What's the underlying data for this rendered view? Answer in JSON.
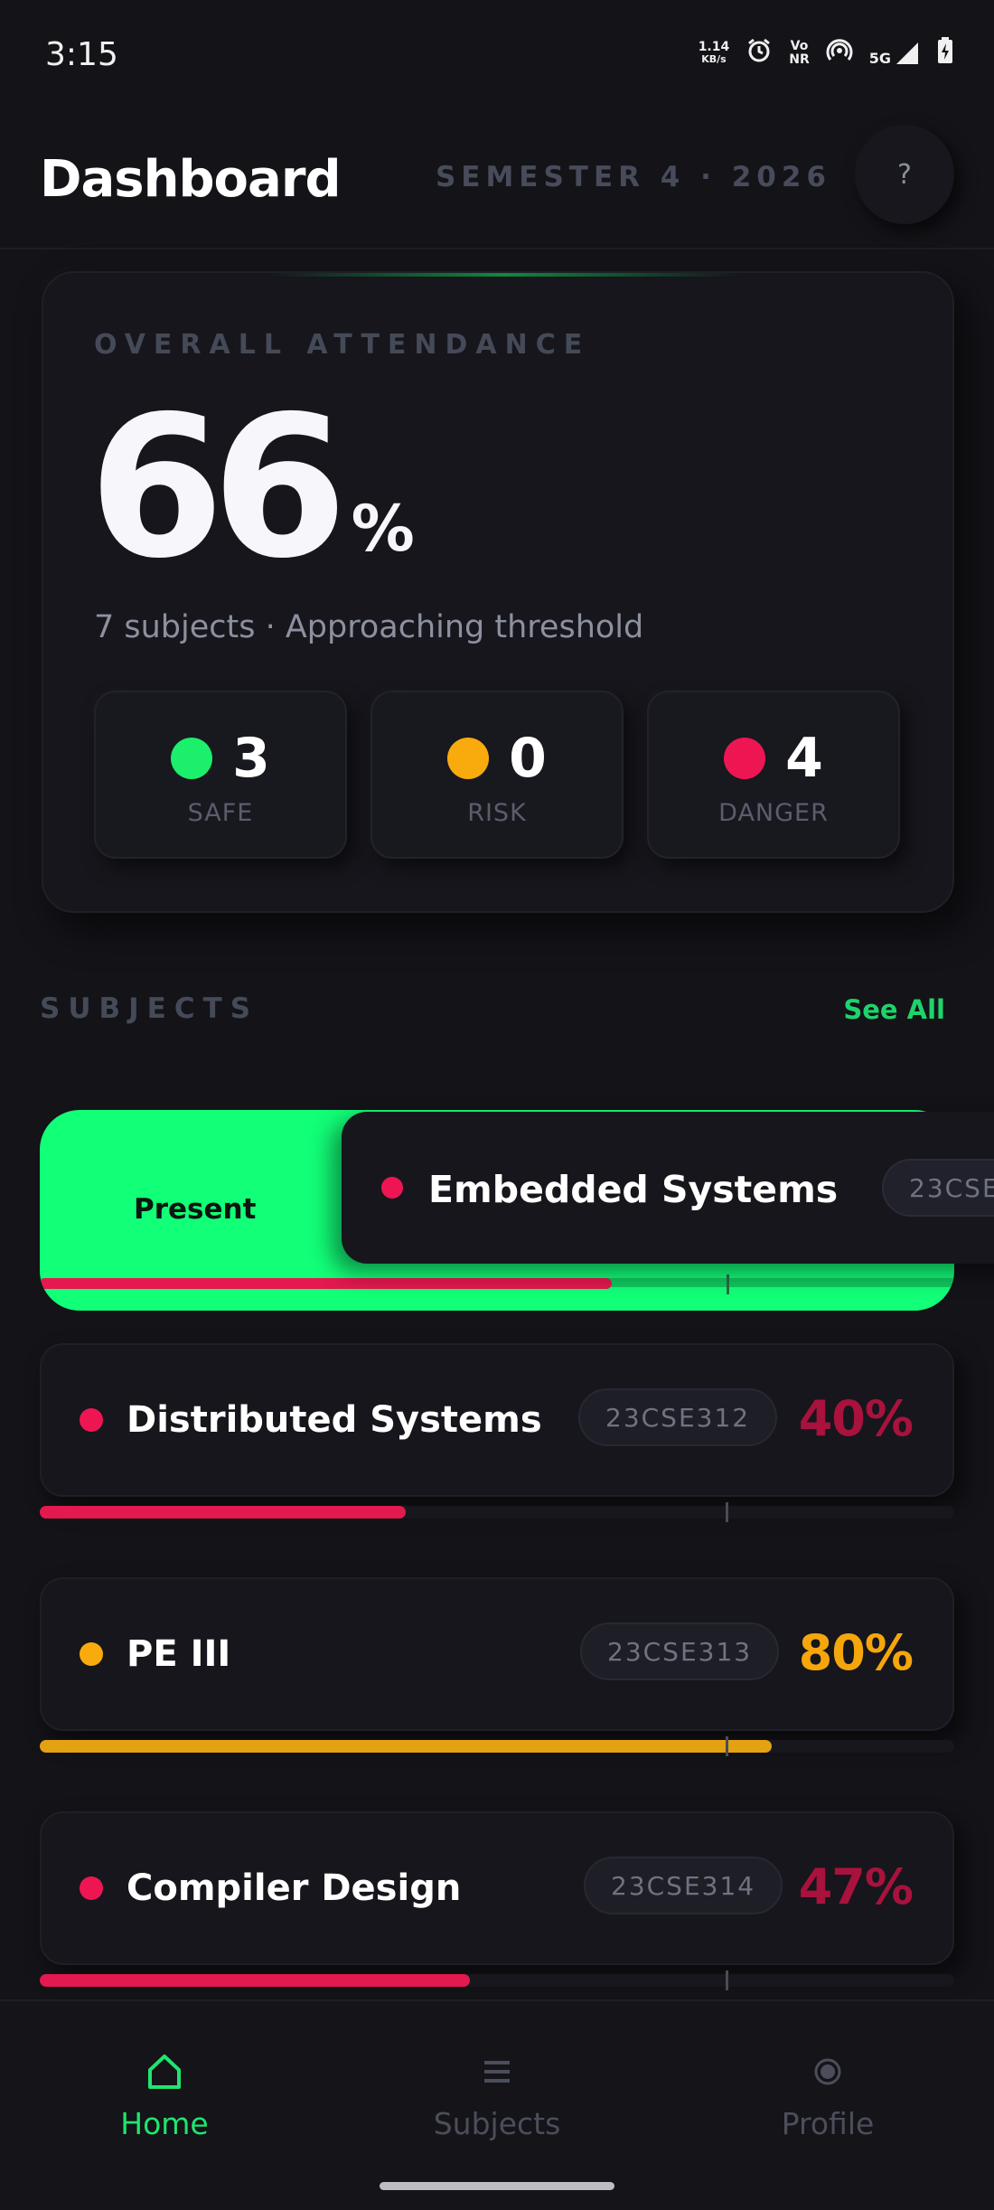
{
  "status_bar": {
    "time": "3:15",
    "net_speed_value": "1.14",
    "net_speed_unit": "KB/s",
    "vonr_top": "Vo",
    "vonr_bottom": "NR",
    "network": "5G"
  },
  "header": {
    "title": "Dashboard",
    "semester": "SEMESTER 4 · 2026",
    "help_label": "?"
  },
  "overall": {
    "label": "OVERALL ATTENDANCE",
    "percent": "66",
    "percent_sign": "%",
    "subtitle": "7 subjects · Approaching threshold",
    "stats": [
      {
        "count": "3",
        "label": "SAFE",
        "color": "#1bef6c"
      },
      {
        "count": "0",
        "label": "RISK",
        "color": "#f9ab0e"
      },
      {
        "count": "4",
        "label": "DANGER",
        "color": "#ee1652"
      }
    ]
  },
  "subjects_section": {
    "title": "SUBJECTS",
    "see_all": "See All"
  },
  "swiped_subject": {
    "action_label": "Present",
    "name": "Embedded Systems",
    "code": "23CSE",
    "status_color": "#ee1652",
    "progress": 0.625
  },
  "subjects": [
    {
      "name": "Distributed Systems",
      "code": "23CSE312",
      "percent": "40%",
      "color": "#ee1652",
      "percent_color": "#a8123c",
      "progress": 0.4
    },
    {
      "name": "PE III",
      "code": "23CSE313",
      "percent": "80%",
      "color": "#f9ab0e",
      "percent_color": "#f5a60c",
      "progress": 0.8
    },
    {
      "name": "Compiler Design",
      "code": "23CSE314",
      "percent": "47%",
      "color": "#ee1652",
      "percent_color": "#a8123c",
      "progress": 0.47
    }
  ],
  "bottom_nav": {
    "items": [
      {
        "label": "Home",
        "active": true
      },
      {
        "label": "Subjects",
        "active": false
      },
      {
        "label": "Profile",
        "active": false
      }
    ],
    "active_color": "#1fe56e",
    "inactive_color": "#4b4e5a"
  },
  "icons": [
    "alarm-icon",
    "hotspot-icon",
    "signal-icon",
    "battery-charging-icon",
    "home-icon",
    "list-icon",
    "profile-icon"
  ]
}
